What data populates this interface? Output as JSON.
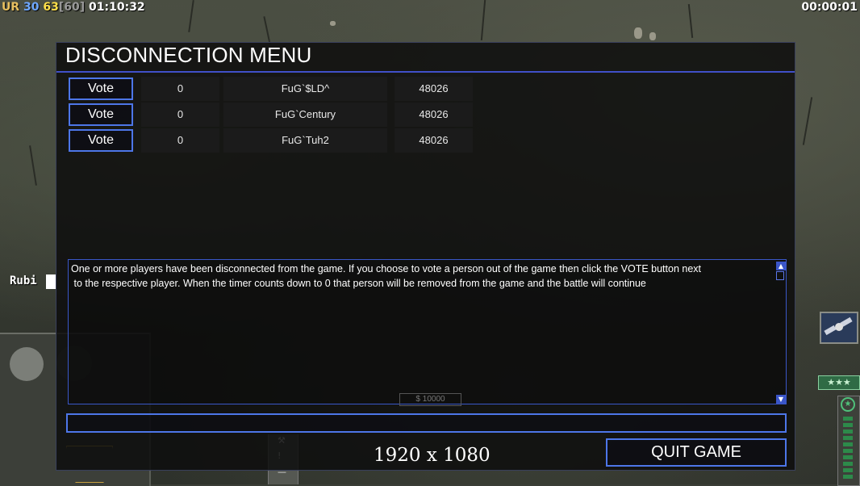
{
  "hud": {
    "faction": "UR",
    "value_a": "30",
    "value_b": "63",
    "value_c": "[60]",
    "game_time": "01:10:32",
    "timer": "00:00:01"
  },
  "dialog": {
    "title": "DISCONNECTION MENU",
    "players": [
      {
        "vote_label": "Vote",
        "votes": "0",
        "name": "FuG`$LD^",
        "ping": "48026"
      },
      {
        "vote_label": "Vote",
        "votes": "0",
        "name": "FuG`Century",
        "ping": "48026"
      },
      {
        "vote_label": "Vote",
        "votes": "0",
        "name": "FuG`Tuh2",
        "ping": "48026"
      }
    ],
    "message_line1": "One or more players have been disconnected from the game. If you choose to vote a person out of the game then click the VOTE button next",
    "message_line2": " to the respective player. When the timer counts down to 0 that person will be removed from the game and the battle will continue",
    "chat_value": "",
    "quit_label": "QUIT GAME"
  },
  "player_tag": "Rubi",
  "money": "$ 10000",
  "resolution_label": "1920 x 1080",
  "colors": {
    "accent_blue": "#4d76e8",
    "title_line": "#4050c8",
    "hud_yellow": "#ffe04a",
    "hud_blue": "#6fa8ff"
  },
  "icons": [
    "satellite-icon",
    "rank-stars-icon",
    "general-star-icon",
    "wrench-icon",
    "alert-icon"
  ]
}
